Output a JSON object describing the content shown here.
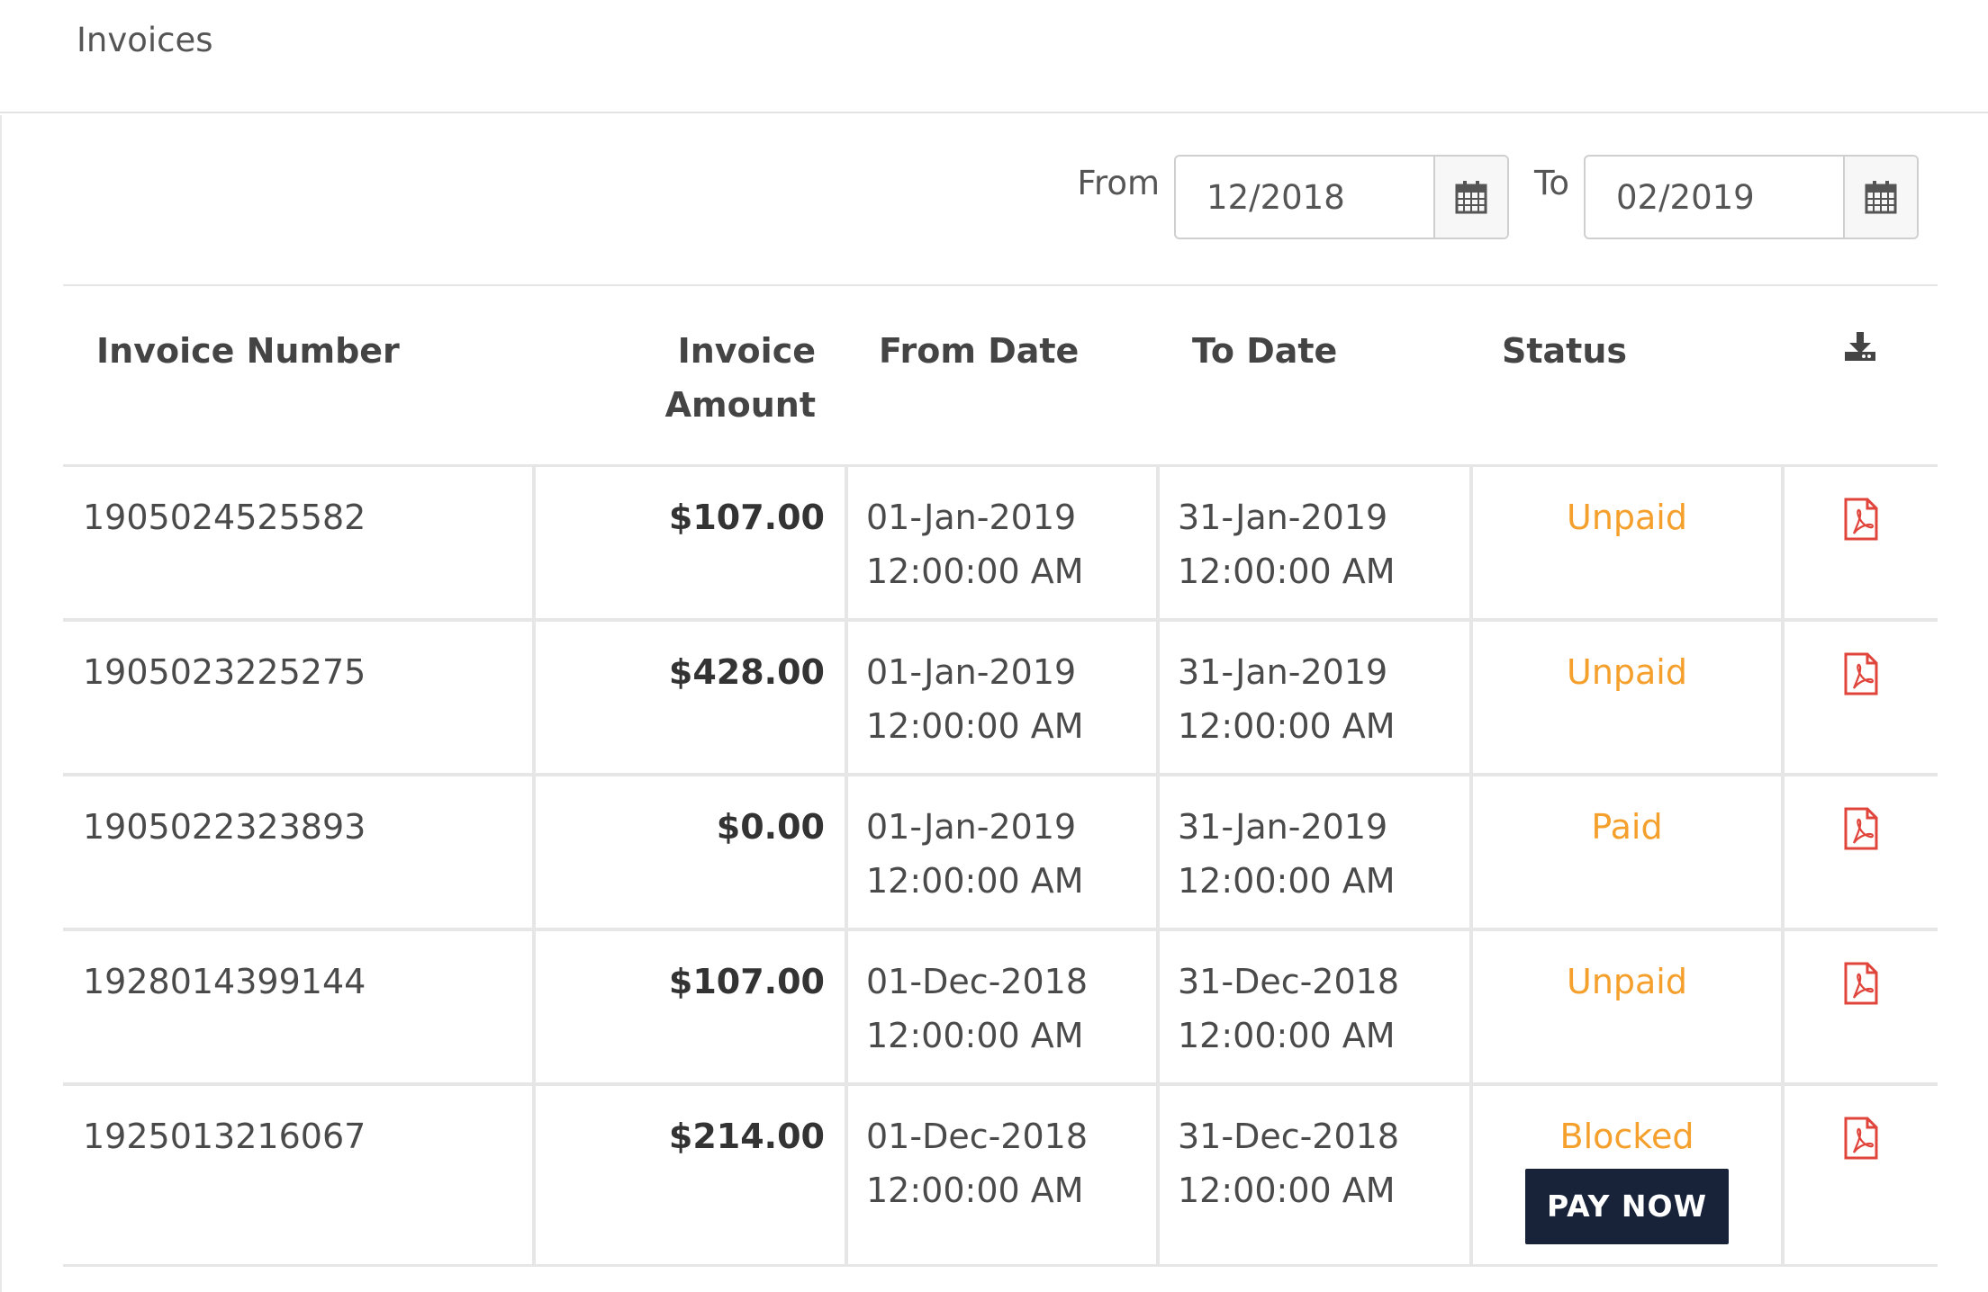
{
  "header": {
    "title": "Invoices"
  },
  "filters": {
    "from_label": "From",
    "from_value": "12/2018",
    "to_label": "To",
    "to_value": "02/2019",
    "calendar_icon": "calendar-icon"
  },
  "table": {
    "columns": {
      "invoice_number": "Invoice Number",
      "invoice_amount_1": "Invoice",
      "invoice_amount_2": "Amount",
      "from_date": "From Date",
      "to_date": "To Date",
      "status": "Status",
      "download_icon": "download-icon"
    },
    "rows": [
      {
        "number": "1905024525582",
        "amount": "$107.00",
        "from_date": "01-Jan-2019",
        "from_time": "12:00:00 AM",
        "to_date": "31-Jan-2019",
        "to_time": "12:00:00 AM",
        "status": "Unpaid",
        "action": ""
      },
      {
        "number": "1905023225275",
        "amount": "$428.00",
        "from_date": "01-Jan-2019",
        "from_time": "12:00:00 AM",
        "to_date": "31-Jan-2019",
        "to_time": "12:00:00 AM",
        "status": "Unpaid",
        "action": ""
      },
      {
        "number": "1905022323893",
        "amount": "$0.00",
        "from_date": "01-Jan-2019",
        "from_time": "12:00:00 AM",
        "to_date": "31-Jan-2019",
        "to_time": "12:00:00 AM",
        "status": "Paid",
        "action": ""
      },
      {
        "number": "1928014399144",
        "amount": "$107.00",
        "from_date": "01-Dec-2018",
        "from_time": "12:00:00 AM",
        "to_date": "31-Dec-2018",
        "to_time": "12:00:00 AM",
        "status": "Unpaid",
        "action": ""
      },
      {
        "number": "1925013216067",
        "amount": "$214.00",
        "from_date": "01-Dec-2018",
        "from_time": "12:00:00 AM",
        "to_date": "31-Dec-2018",
        "to_time": "12:00:00 AM",
        "status": "Blocked",
        "action": "PAY NOW"
      }
    ],
    "pdf_icon": "pdf-file-icon"
  },
  "colors": {
    "status": "#f5a02c",
    "pdf_icon": "#e0443b",
    "pay_button_bg": "#18233a",
    "text": "#4a4a4a",
    "border": "#e6e6e6"
  }
}
